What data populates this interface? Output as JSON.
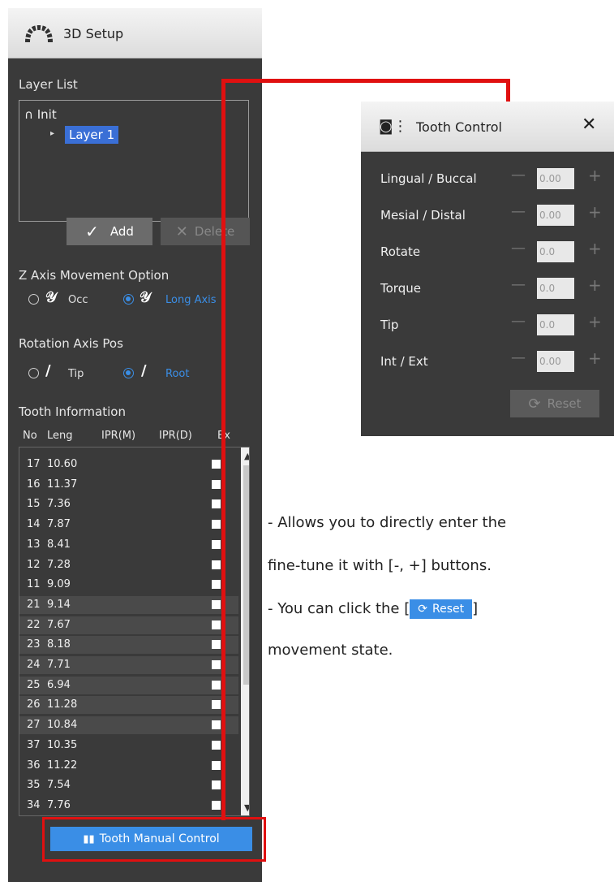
{
  "panel": {
    "title": "3D Setup",
    "layer_list_label": "Layer List",
    "layer_root": "Init",
    "layer_selected": "Layer 1",
    "add_label": "Add",
    "delete_label": "Delete",
    "z_axis_label": "Z Axis Movement Option",
    "z_opt1": "Occ",
    "z_opt2": "Long Axis",
    "rotation_label": "Rotation Axis Pos",
    "rot_opt1": "Tip",
    "rot_opt2": "Root",
    "tooth_info_label": "Tooth Information",
    "columns": [
      "No",
      "Leng",
      "IPR(M)",
      "IPR(D)",
      "Ex"
    ],
    "rows": [
      {
        "no": "17",
        "len": "10.60"
      },
      {
        "no": "16",
        "len": "11.37"
      },
      {
        "no": "15",
        "len": "7.36"
      },
      {
        "no": "14",
        "len": "7.87"
      },
      {
        "no": "13",
        "len": "8.41"
      },
      {
        "no": "12",
        "len": "7.28"
      },
      {
        "no": "11",
        "len": "9.09"
      },
      {
        "no": "21",
        "len": "9.14"
      },
      {
        "no": "22",
        "len": "7.67"
      },
      {
        "no": "23",
        "len": "8.18"
      },
      {
        "no": "24",
        "len": "7.71"
      },
      {
        "no": "25",
        "len": "6.94"
      },
      {
        "no": "26",
        "len": "11.28"
      },
      {
        "no": "27",
        "len": "10.84"
      },
      {
        "no": "37",
        "len": "10.35"
      },
      {
        "no": "36",
        "len": "11.22"
      },
      {
        "no": "35",
        "len": "7.54"
      },
      {
        "no": "34",
        "len": "7.76"
      }
    ],
    "manual_button": "Tooth Manual Control"
  },
  "dialog": {
    "title": "Tooth Control",
    "controls": [
      {
        "label": "Lingual / Buccal",
        "value": "0.00"
      },
      {
        "label": "Mesial / Distal",
        "value": "0.00"
      },
      {
        "label": "Rotate",
        "value": "0.0"
      },
      {
        "label": "Torque",
        "value": "0.0"
      },
      {
        "label": "Tip",
        "value": "0.0"
      },
      {
        "label": "Int / Ext",
        "value": "0.00"
      }
    ],
    "reset_label": "Reset"
  },
  "text": {
    "line1": "- Allows you to directly enter the",
    "line2": "fine-tune it with [-, +] buttons.",
    "line3_pre": "- You  can  click  the  [",
    "line3_post": "]",
    "line4": "movement state.",
    "inline_reset": "Reset"
  },
  "colors": {
    "highlight_red": "#e01010",
    "accent_blue": "#3a8ee6",
    "panel_bg": "#3a3a3a"
  }
}
